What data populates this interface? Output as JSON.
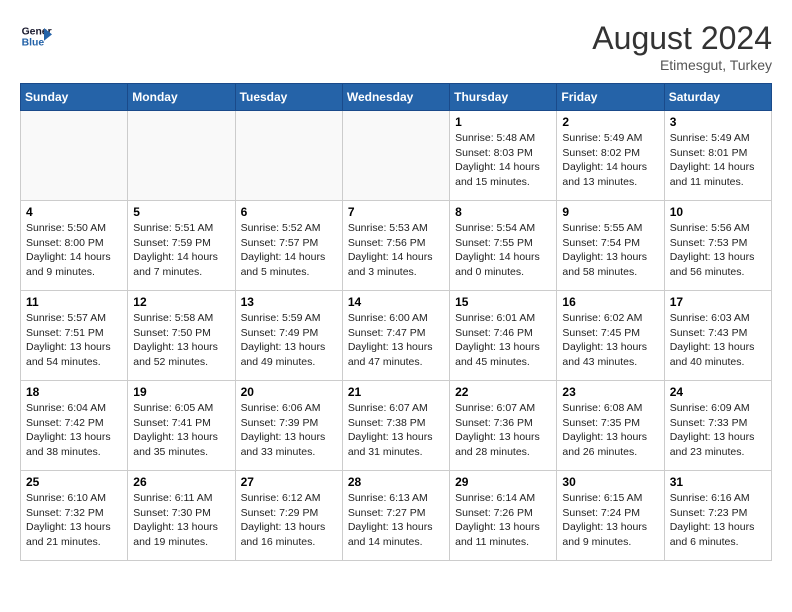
{
  "header": {
    "logo_line1": "General",
    "logo_line2": "Blue",
    "month_year": "August 2024",
    "location": "Etimesgut, Turkey"
  },
  "days_of_week": [
    "Sunday",
    "Monday",
    "Tuesday",
    "Wednesday",
    "Thursday",
    "Friday",
    "Saturday"
  ],
  "weeks": [
    [
      {
        "day": "",
        "content": ""
      },
      {
        "day": "",
        "content": ""
      },
      {
        "day": "",
        "content": ""
      },
      {
        "day": "",
        "content": ""
      },
      {
        "day": "1",
        "content": "Sunrise: 5:48 AM\nSunset: 8:03 PM\nDaylight: 14 hours\nand 15 minutes."
      },
      {
        "day": "2",
        "content": "Sunrise: 5:49 AM\nSunset: 8:02 PM\nDaylight: 14 hours\nand 13 minutes."
      },
      {
        "day": "3",
        "content": "Sunrise: 5:49 AM\nSunset: 8:01 PM\nDaylight: 14 hours\nand 11 minutes."
      }
    ],
    [
      {
        "day": "4",
        "content": "Sunrise: 5:50 AM\nSunset: 8:00 PM\nDaylight: 14 hours\nand 9 minutes."
      },
      {
        "day": "5",
        "content": "Sunrise: 5:51 AM\nSunset: 7:59 PM\nDaylight: 14 hours\nand 7 minutes."
      },
      {
        "day": "6",
        "content": "Sunrise: 5:52 AM\nSunset: 7:57 PM\nDaylight: 14 hours\nand 5 minutes."
      },
      {
        "day": "7",
        "content": "Sunrise: 5:53 AM\nSunset: 7:56 PM\nDaylight: 14 hours\nand 3 minutes."
      },
      {
        "day": "8",
        "content": "Sunrise: 5:54 AM\nSunset: 7:55 PM\nDaylight: 14 hours\nand 0 minutes."
      },
      {
        "day": "9",
        "content": "Sunrise: 5:55 AM\nSunset: 7:54 PM\nDaylight: 13 hours\nand 58 minutes."
      },
      {
        "day": "10",
        "content": "Sunrise: 5:56 AM\nSunset: 7:53 PM\nDaylight: 13 hours\nand 56 minutes."
      }
    ],
    [
      {
        "day": "11",
        "content": "Sunrise: 5:57 AM\nSunset: 7:51 PM\nDaylight: 13 hours\nand 54 minutes."
      },
      {
        "day": "12",
        "content": "Sunrise: 5:58 AM\nSunset: 7:50 PM\nDaylight: 13 hours\nand 52 minutes."
      },
      {
        "day": "13",
        "content": "Sunrise: 5:59 AM\nSunset: 7:49 PM\nDaylight: 13 hours\nand 49 minutes."
      },
      {
        "day": "14",
        "content": "Sunrise: 6:00 AM\nSunset: 7:47 PM\nDaylight: 13 hours\nand 47 minutes."
      },
      {
        "day": "15",
        "content": "Sunrise: 6:01 AM\nSunset: 7:46 PM\nDaylight: 13 hours\nand 45 minutes."
      },
      {
        "day": "16",
        "content": "Sunrise: 6:02 AM\nSunset: 7:45 PM\nDaylight: 13 hours\nand 43 minutes."
      },
      {
        "day": "17",
        "content": "Sunrise: 6:03 AM\nSunset: 7:43 PM\nDaylight: 13 hours\nand 40 minutes."
      }
    ],
    [
      {
        "day": "18",
        "content": "Sunrise: 6:04 AM\nSunset: 7:42 PM\nDaylight: 13 hours\nand 38 minutes."
      },
      {
        "day": "19",
        "content": "Sunrise: 6:05 AM\nSunset: 7:41 PM\nDaylight: 13 hours\nand 35 minutes."
      },
      {
        "day": "20",
        "content": "Sunrise: 6:06 AM\nSunset: 7:39 PM\nDaylight: 13 hours\nand 33 minutes."
      },
      {
        "day": "21",
        "content": "Sunrise: 6:07 AM\nSunset: 7:38 PM\nDaylight: 13 hours\nand 31 minutes."
      },
      {
        "day": "22",
        "content": "Sunrise: 6:07 AM\nSunset: 7:36 PM\nDaylight: 13 hours\nand 28 minutes."
      },
      {
        "day": "23",
        "content": "Sunrise: 6:08 AM\nSunset: 7:35 PM\nDaylight: 13 hours\nand 26 minutes."
      },
      {
        "day": "24",
        "content": "Sunrise: 6:09 AM\nSunset: 7:33 PM\nDaylight: 13 hours\nand 23 minutes."
      }
    ],
    [
      {
        "day": "25",
        "content": "Sunrise: 6:10 AM\nSunset: 7:32 PM\nDaylight: 13 hours\nand 21 minutes."
      },
      {
        "day": "26",
        "content": "Sunrise: 6:11 AM\nSunset: 7:30 PM\nDaylight: 13 hours\nand 19 minutes."
      },
      {
        "day": "27",
        "content": "Sunrise: 6:12 AM\nSunset: 7:29 PM\nDaylight: 13 hours\nand 16 minutes."
      },
      {
        "day": "28",
        "content": "Sunrise: 6:13 AM\nSunset: 7:27 PM\nDaylight: 13 hours\nand 14 minutes."
      },
      {
        "day": "29",
        "content": "Sunrise: 6:14 AM\nSunset: 7:26 PM\nDaylight: 13 hours\nand 11 minutes."
      },
      {
        "day": "30",
        "content": "Sunrise: 6:15 AM\nSunset: 7:24 PM\nDaylight: 13 hours\nand 9 minutes."
      },
      {
        "day": "31",
        "content": "Sunrise: 6:16 AM\nSunset: 7:23 PM\nDaylight: 13 hours\nand 6 minutes."
      }
    ]
  ]
}
